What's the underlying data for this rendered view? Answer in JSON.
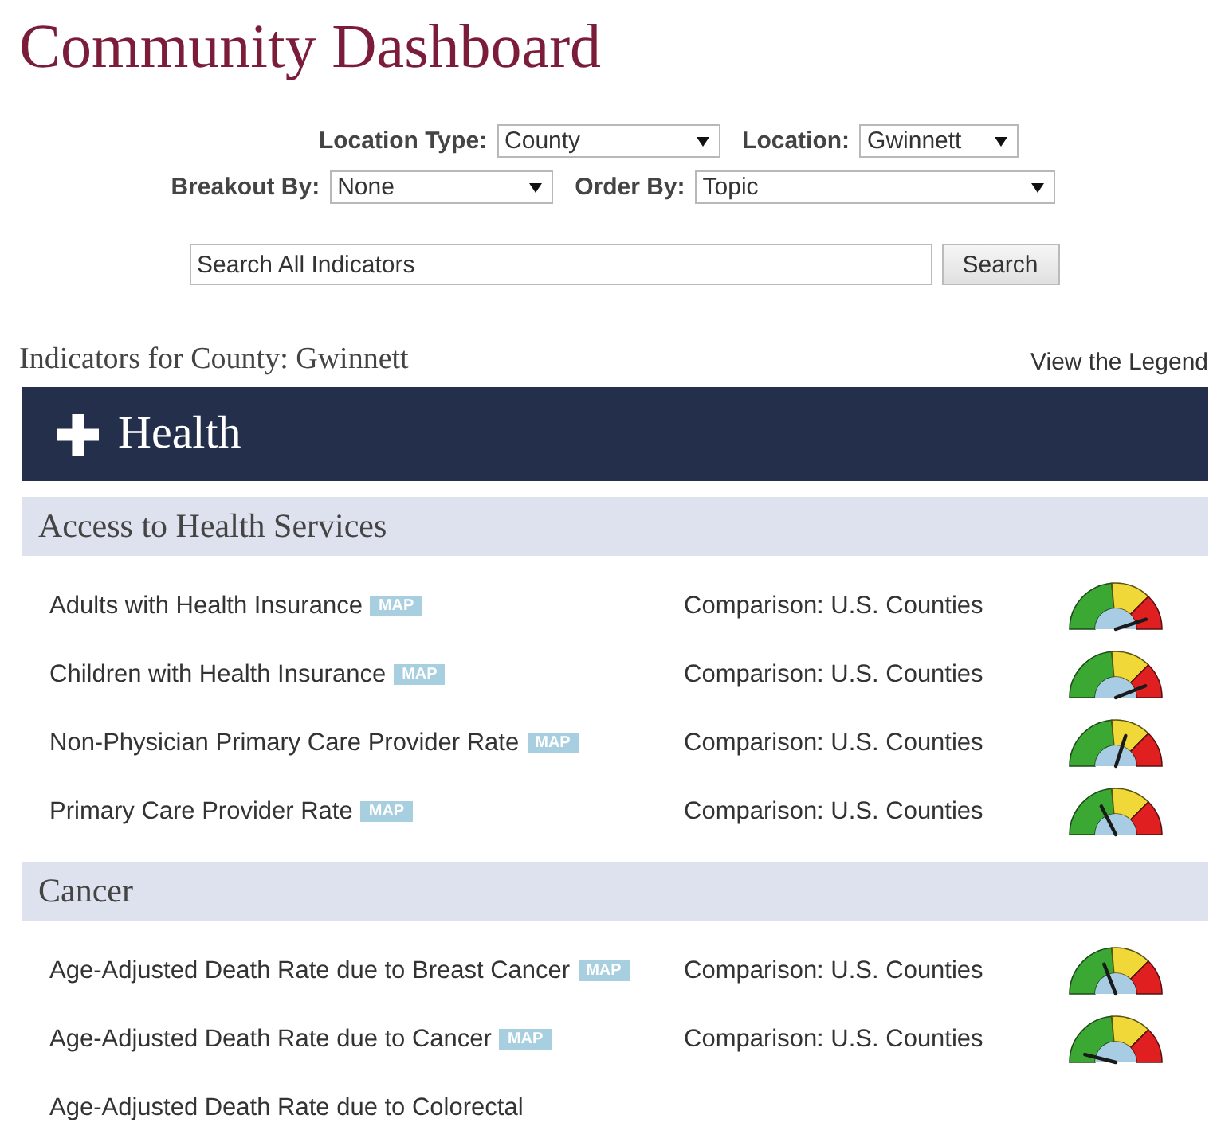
{
  "title": "Community Dashboard",
  "filters": [
    {
      "label": "Location Type:",
      "value": "County"
    },
    {
      "label": "Location:",
      "value": "Gwinnett"
    },
    {
      "label": "Breakout By:",
      "value": "None"
    },
    {
      "label": "Order By:",
      "value": "Topic"
    }
  ],
  "search": {
    "value": "Search All Indicators",
    "button": "Search"
  },
  "heading": "Indicators for County: Gwinnett",
  "legend_link": "View the Legend",
  "topic": {
    "title": "Health"
  },
  "sections": [
    {
      "title": "Access to Health Services",
      "indicators": [
        {
          "name": "Adults with Health Insurance",
          "badge": "MAP",
          "comparison": "Comparison: U.S. Counties"
        },
        {
          "name": "Children with Health Insurance",
          "badge": "MAP",
          "comparison": "Comparison: U.S. Counties"
        },
        {
          "name": "Non-Physician Primary Care Provider Rate",
          "badge": "MAP",
          "comparison": "Comparison: U.S. Counties"
        },
        {
          "name": "Primary Care Provider Rate",
          "badge": "MAP",
          "comparison": "Comparison: U.S. Counties"
        }
      ]
    },
    {
      "title": "Cancer",
      "indicators": [
        {
          "name": "Age-Adjusted Death Rate due to Breast Cancer",
          "badge": "MAP",
          "comparison": "Comparison: U.S. Counties"
        },
        {
          "name": "Age-Adjusted Death Rate due to Cancer",
          "badge": "MAP",
          "comparison": "Comparison: U.S. Counties"
        },
        {
          "name": "Age-Adjusted Death Rate due to Colorectal"
        }
      ]
    }
  ]
}
